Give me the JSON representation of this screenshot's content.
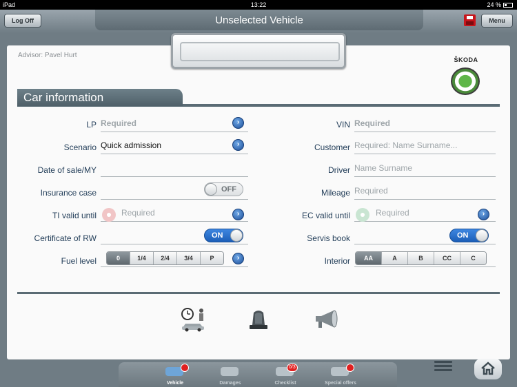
{
  "status_bar": {
    "device": "iPad",
    "time": "13:22",
    "battery": "24 %"
  },
  "header": {
    "title": "Unselected Vehicle",
    "logoff_label": "Log Off",
    "menu_label": "Menu"
  },
  "advisor": "Advisor: Pavel Hurt",
  "brand": "ŠKODA",
  "section_title": "Car information",
  "form": {
    "lp": {
      "label": "LP",
      "placeholder": "Required"
    },
    "scenario": {
      "label": "Scenario",
      "value": "Quick admission"
    },
    "date_of_sale": {
      "label": "Date of sale/MY",
      "value": ""
    },
    "insurance": {
      "label": "Insurance case",
      "toggle": "OFF"
    },
    "ti_valid": {
      "label": "TI valid until",
      "placeholder": "Required"
    },
    "certificate": {
      "label": "Certificate of RW",
      "toggle": "ON"
    },
    "fuel": {
      "label": "Fuel level",
      "options": [
        "0",
        "1/4",
        "2/4",
        "3/4",
        "P"
      ],
      "selected": "0"
    },
    "vin": {
      "label": "VIN",
      "placeholder": "Required"
    },
    "customer": {
      "label": "Customer",
      "placeholder": "Required: Name Surname..."
    },
    "driver": {
      "label": "Driver",
      "placeholder": "Name Surname"
    },
    "mileage": {
      "label": "Mileage",
      "placeholder": "Required"
    },
    "ec_valid": {
      "label": "EC valid until",
      "placeholder": "Required"
    },
    "servis_book": {
      "label": "Servis book",
      "toggle": "ON"
    },
    "interior": {
      "label": "Interior",
      "options": [
        "AA",
        "A",
        "B",
        "CC",
        "C"
      ],
      "selected": "AA"
    }
  },
  "actions": [
    {
      "name": "appointment-icon"
    },
    {
      "name": "beacon-icon"
    },
    {
      "name": "megaphone-icon"
    }
  ],
  "bottom_tabs": [
    {
      "label": "Vehicle",
      "badge": ""
    },
    {
      "label": "Damages",
      "badge": ""
    },
    {
      "label": "Checklist",
      "badge": "0/3"
    },
    {
      "label": "Special offers",
      "badge": ""
    }
  ],
  "colors": {
    "accent": "#1c5fb8",
    "header": "#5e6b73",
    "label": "#243f5a",
    "badge": "#e02020"
  }
}
